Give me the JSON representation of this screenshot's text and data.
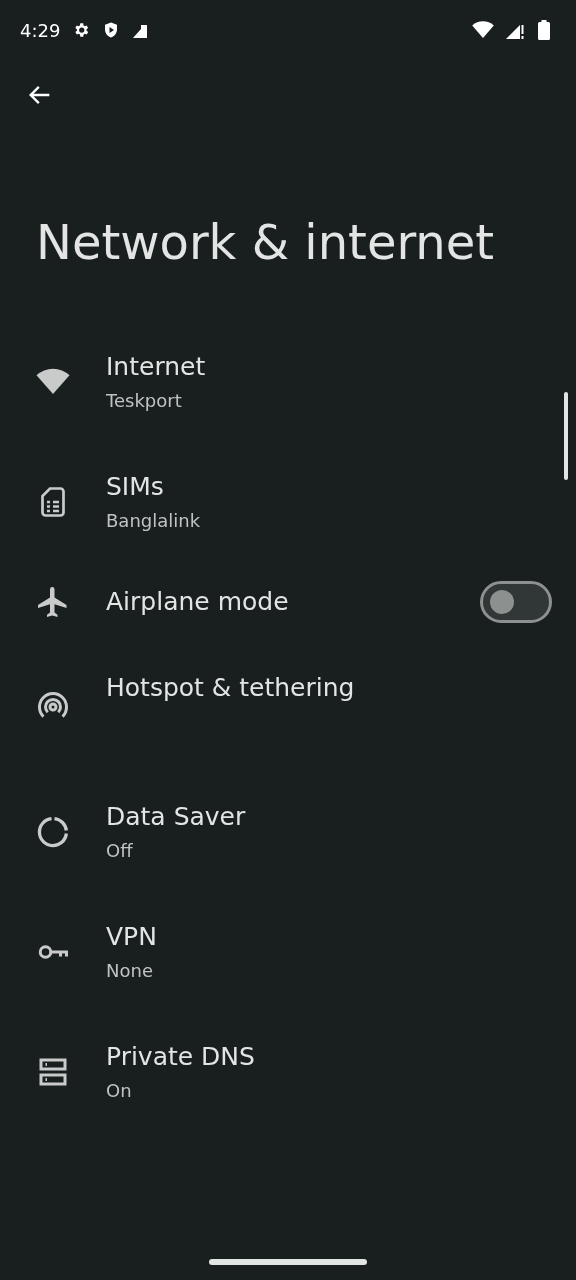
{
  "status_bar": {
    "time": "4:29"
  },
  "title": "Network & internet",
  "items": [
    {
      "kind": "nav",
      "title": "Internet",
      "summary": "Teskport"
    },
    {
      "kind": "nav",
      "title": "SIMs",
      "summary": "Banglalink"
    },
    {
      "kind": "switch",
      "title": "Airplane mode",
      "on": false
    },
    {
      "kind": "nav",
      "title": "Hotspot & tethering"
    },
    {
      "kind": "nav",
      "title": "Data Saver",
      "summary": "Off"
    },
    {
      "kind": "nav",
      "title": "VPN",
      "summary": "None"
    },
    {
      "kind": "nav",
      "title": "Private DNS",
      "summary": "On"
    }
  ]
}
